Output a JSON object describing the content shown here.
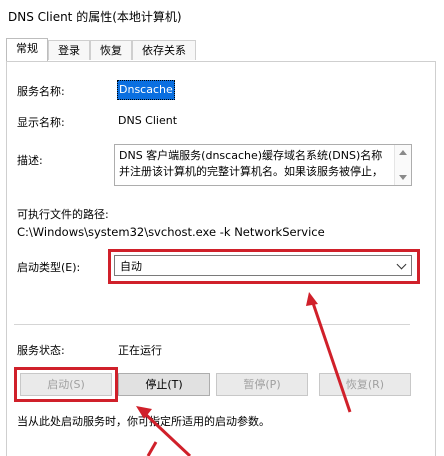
{
  "window": {
    "title": "DNS Client 的属性(本地计算机)"
  },
  "tabs": [
    {
      "label": "常规",
      "active": true
    },
    {
      "label": "登录",
      "active": false
    },
    {
      "label": "恢复",
      "active": false
    },
    {
      "label": "依存关系",
      "active": false
    }
  ],
  "general": {
    "service_name_label": "服务名称:",
    "service_name_value": "Dnscache",
    "display_name_label": "显示名称:",
    "display_name_value": "DNS Client",
    "description_label": "描述:",
    "description_text": "DNS 客户端服务(dnscache)缓存域名系统(DNS)名称\n并注册该计算机的完整计算机名。如果该服务被停止，",
    "exe_path_label": "可执行文件的路径:",
    "exe_path_value": "C:\\Windows\\system32\\svchost.exe -k NetworkService",
    "startup_type_label": "启动类型(E):",
    "startup_type_value": "自动",
    "service_status_label": "服务状态:",
    "service_status_value": "正在运行",
    "hint_text": "当从此处启动服务时，你可指定所适用的启动参数。"
  },
  "buttons": {
    "start": "启动(S)",
    "stop": "停止(T)",
    "pause": "暂停(P)",
    "resume": "恢复(R)"
  },
  "colors": {
    "annotation_red": "#d0202a",
    "selection_blue": "#0a6fe0"
  },
  "icons": {
    "combo_arrow": "chevron-down-icon",
    "scroll_up": "arrow-up-icon",
    "scroll_down": "arrow-down-icon"
  }
}
